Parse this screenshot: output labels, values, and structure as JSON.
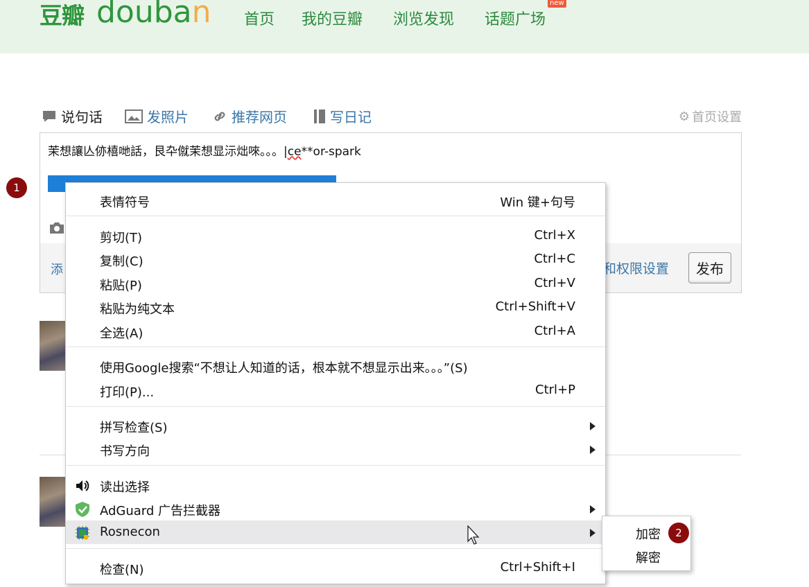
{
  "header": {
    "logo_cn": "豆瓣",
    "logo_en_d": "douba",
    "logo_en_a": "n",
    "nav": [
      "首页",
      "我的豆瓣",
      "浏览发现",
      "话题广场"
    ],
    "new_badge": "new"
  },
  "tabs": {
    "items": [
      "说句话",
      "发照片",
      "推荐网页",
      "写日记"
    ],
    "home_settings": "首页设置"
  },
  "editor": {
    "line1_text": "茉想讓亾㑊橲哋話，艮卆僦茉想显沶炪唻。。。|",
    "line1_spell": "ce",
    "line1_tail": "**or-spark",
    "footer_left": "添",
    "permissions": "和权限设置",
    "publish": "发布"
  },
  "markers": {
    "m1": "1",
    "m2": "2"
  },
  "context_menu": {
    "emoji": {
      "label": "表情符号",
      "shortcut": "Win 键+句号"
    },
    "cut": {
      "label": "剪切(T)",
      "shortcut": "Ctrl+X"
    },
    "copy": {
      "label": "复制(C)",
      "shortcut": "Ctrl+C"
    },
    "paste": {
      "label": "粘贴(P)",
      "shortcut": "Ctrl+V"
    },
    "paste_plain": {
      "label": "粘贴为纯文本",
      "shortcut": "Ctrl+Shift+V"
    },
    "select_all": {
      "label": "全选(A)",
      "shortcut": "Ctrl+A"
    },
    "google": {
      "label": "使用Google搜索“不想让人知道的话，根本就不想显示出来。。。”(S)"
    },
    "print": {
      "label": "打印(P)...",
      "shortcut": "Ctrl+P"
    },
    "spell": {
      "label": "拼写检查(S)"
    },
    "direction": {
      "label": "书写方向"
    },
    "read_aloud": {
      "label": "读出选择"
    },
    "adguard": {
      "label": "AdGuard 广告拦截器"
    },
    "rosnecon": {
      "label": "Rosnecon"
    },
    "inspect": {
      "label": "检查(N)",
      "shortcut": "Ctrl+Shift+I"
    }
  },
  "submenu": {
    "encrypt": "加密",
    "decrypt": "解密"
  }
}
